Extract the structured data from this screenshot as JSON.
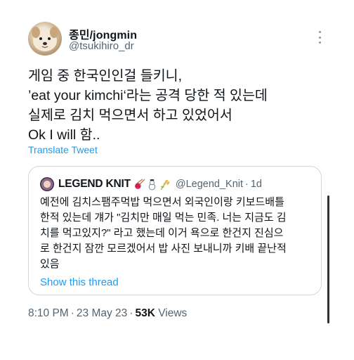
{
  "author": {
    "display_name": "종민/jongmin",
    "handle": "@tsukihiro_dr"
  },
  "tweet": {
    "text": "게임 중 한국인인걸 들키니,\n’eat your kimchi‘라는 공격 당한 적 있는데\n실제로 김치 먹으면서 하고 있었어서\nOk I will 함..",
    "translate_label": "Translate Tweet"
  },
  "quoted": {
    "display_name": "LEGEND KNIT",
    "emojis": [
      "knitting-emoji",
      "snowman-emoji",
      "wheat-emoji"
    ],
    "handle": "@Legend_Knit",
    "separator": "·",
    "time": "1d",
    "text": "예전에 김치스팸주먹밥 먹으면서 외국인이랑 키보드배틀\n한적 있는데 걔가 \"김치만 매일 먹는 민족. 너는 지금도 김\n치를 먹고있지?\" 라고 했는데 이거 욕으로 한건지 진심으\n로 한건지 잠깐 모르겠어서 밥 사진 보내니까 키배 끝난적\n있음",
    "show_thread_label": "Show this thread"
  },
  "meta": {
    "time": "8:10 PM",
    "date": "23 May 23",
    "separator": "·",
    "views_count": "53K",
    "views_label": "Views"
  },
  "colors": {
    "link": "#1d9bf0",
    "secondary_text": "#536471",
    "border": "#cfd9de"
  }
}
